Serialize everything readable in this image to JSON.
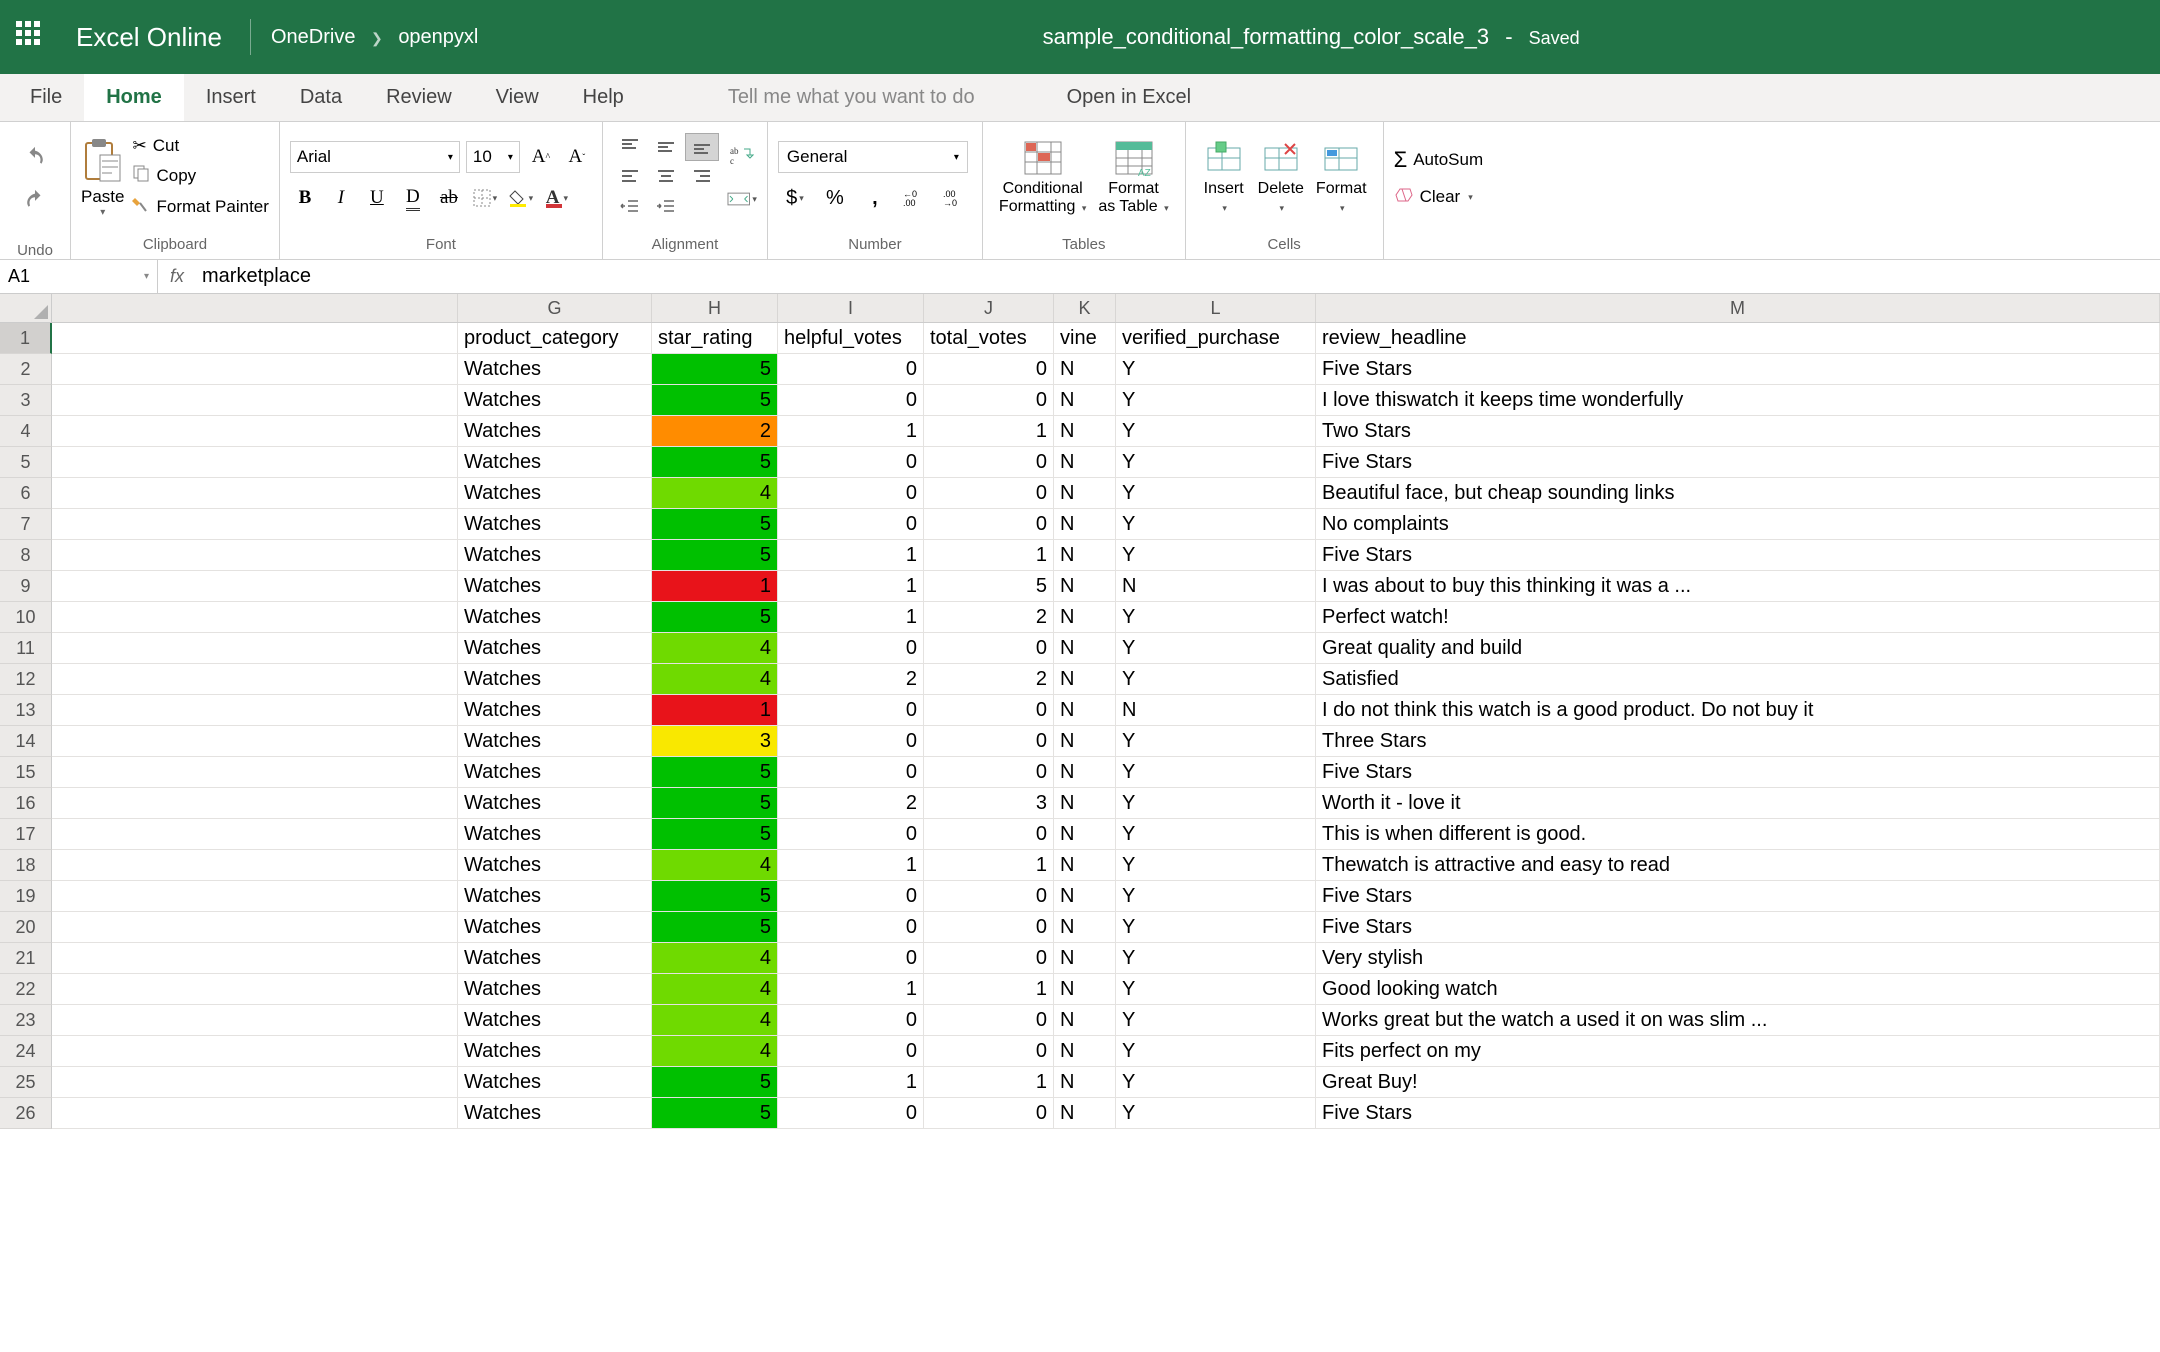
{
  "header": {
    "app_name": "Excel Online",
    "breadcrumb": [
      "OneDrive",
      "openpyxl"
    ],
    "doc_title": "sample_conditional_formatting_color_scale_3",
    "saved_status": "Saved"
  },
  "tabs": {
    "items": [
      "File",
      "Home",
      "Insert",
      "Data",
      "Review",
      "View",
      "Help"
    ],
    "active": "Home",
    "tell_me": "Tell me what you want to do",
    "open_in_excel": "Open in Excel"
  },
  "ribbon": {
    "undo_label": "Undo",
    "clipboard": {
      "paste": "Paste",
      "cut": "Cut",
      "copy": "Copy",
      "format_painter": "Format Painter",
      "label": "Clipboard"
    },
    "font": {
      "name": "Arial",
      "size": "10",
      "label": "Font"
    },
    "alignment": {
      "label": "Alignment"
    },
    "number": {
      "format": "General",
      "label": "Number"
    },
    "tables": {
      "cond_format": "Conditional\nFormatting",
      "as_table": "Format\nas Table",
      "label": "Tables"
    },
    "cells": {
      "insert": "Insert",
      "delete": "Delete",
      "format": "Format",
      "label": "Cells"
    },
    "editing": {
      "autosum": "AutoSum",
      "clear": "Clear"
    }
  },
  "formula_bar": {
    "name_box": "A1",
    "formula": "marketplace"
  },
  "grid": {
    "columns": [
      "G",
      "H",
      "I",
      "J",
      "K",
      "L",
      "M"
    ],
    "col_widths_key": [
      "cF",
      "cG",
      "cH",
      "cI",
      "cJ",
      "cK",
      "cL",
      "cM"
    ],
    "header_row": [
      "product_category",
      "star_rating",
      "helpful_votes",
      "total_votes",
      "vine",
      "verified_purchase",
      "review_headline"
    ],
    "rows": [
      {
        "g": "Watches",
        "h": 5,
        "i": 0,
        "j": 0,
        "k": "N",
        "l": "Y",
        "m": "Five Stars",
        "hc": "#00C000"
      },
      {
        "g": "Watches",
        "h": 5,
        "i": 0,
        "j": 0,
        "k": "N",
        "l": "Y",
        "m": "I love thiswatch it keeps time wonderfully",
        "hc": "#00C000"
      },
      {
        "g": "Watches",
        "h": 2,
        "i": 1,
        "j": 1,
        "k": "N",
        "l": "Y",
        "m": "Two Stars",
        "hc": "#FF8C00"
      },
      {
        "g": "Watches",
        "h": 5,
        "i": 0,
        "j": 0,
        "k": "N",
        "l": "Y",
        "m": "Five Stars",
        "hc": "#00C000"
      },
      {
        "g": "Watches",
        "h": 4,
        "i": 0,
        "j": 0,
        "k": "N",
        "l": "Y",
        "m": "Beautiful face, but cheap sounding links",
        "hc": "#6FDA00"
      },
      {
        "g": "Watches",
        "h": 5,
        "i": 0,
        "j": 0,
        "k": "N",
        "l": "Y",
        "m": "No complaints",
        "hc": "#00C000"
      },
      {
        "g": "Watches",
        "h": 5,
        "i": 1,
        "j": 1,
        "k": "N",
        "l": "Y",
        "m": "Five Stars",
        "hc": "#00C000"
      },
      {
        "g": "Watches",
        "h": 1,
        "i": 1,
        "j": 5,
        "k": "N",
        "l": "N",
        "m": "I was about to buy this thinking it was a ...",
        "hc": "#E8131A"
      },
      {
        "g": "Watches",
        "h": 5,
        "i": 1,
        "j": 2,
        "k": "N",
        "l": "Y",
        "m": "Perfect watch!",
        "hc": "#00C000"
      },
      {
        "g": "Watches",
        "h": 4,
        "i": 0,
        "j": 0,
        "k": "N",
        "l": "Y",
        "m": "Great quality and build",
        "hc": "#6FDA00"
      },
      {
        "g": "Watches",
        "h": 4,
        "i": 2,
        "j": 2,
        "k": "N",
        "l": "Y",
        "m": "Satisfied",
        "hc": "#6FDA00"
      },
      {
        "g": "Watches",
        "h": 1,
        "i": 0,
        "j": 0,
        "k": "N",
        "l": "N",
        "m": "I do not think this watch is a good product. Do not buy it",
        "hc": "#E8131A"
      },
      {
        "g": "Watches",
        "h": 3,
        "i": 0,
        "j": 0,
        "k": "N",
        "l": "Y",
        "m": "Three Stars",
        "hc": "#F9E800"
      },
      {
        "g": "Watches",
        "h": 5,
        "i": 0,
        "j": 0,
        "k": "N",
        "l": "Y",
        "m": "Five Stars",
        "hc": "#00C000"
      },
      {
        "g": "Watches",
        "h": 5,
        "i": 2,
        "j": 3,
        "k": "N",
        "l": "Y",
        "m": "Worth it - love it",
        "hc": "#00C000"
      },
      {
        "g": "Watches",
        "h": 5,
        "i": 0,
        "j": 0,
        "k": "N",
        "l": "Y",
        "m": "This is when different is good.",
        "hc": "#00C000"
      },
      {
        "g": "Watches",
        "h": 4,
        "i": 1,
        "j": 1,
        "k": "N",
        "l": "Y",
        "m": "Thewatch is attractive and easy to read",
        "hc": "#6FDA00"
      },
      {
        "g": "Watches",
        "h": 5,
        "i": 0,
        "j": 0,
        "k": "N",
        "l": "Y",
        "m": "Five Stars",
        "hc": "#00C000"
      },
      {
        "g": "Watches",
        "h": 5,
        "i": 0,
        "j": 0,
        "k": "N",
        "l": "Y",
        "m": "Five Stars",
        "hc": "#00C000"
      },
      {
        "g": "Watches",
        "h": 4,
        "i": 0,
        "j": 0,
        "k": "N",
        "l": "Y",
        "m": "Very stylish",
        "hc": "#6FDA00"
      },
      {
        "g": "Watches",
        "h": 4,
        "i": 1,
        "j": 1,
        "k": "N",
        "l": "Y",
        "m": "Good looking watch",
        "hc": "#6FDA00"
      },
      {
        "g": "Watches",
        "h": 4,
        "i": 0,
        "j": 0,
        "k": "N",
        "l": "Y",
        "m": "Works great but the watch a used it on was slim ...",
        "hc": "#6FDA00"
      },
      {
        "g": "Watches",
        "h": 4,
        "i": 0,
        "j": 0,
        "k": "N",
        "l": "Y",
        "m": "Fits perfect on my",
        "hc": "#6FDA00"
      },
      {
        "g": "Watches",
        "h": 5,
        "i": 1,
        "j": 1,
        "k": "N",
        "l": "Y",
        "m": "Great Buy!",
        "hc": "#00C000"
      },
      {
        "g": "Watches",
        "h": 5,
        "i": 0,
        "j": 0,
        "k": "N",
        "l": "Y",
        "m": "Five Stars",
        "hc": "#00C000"
      }
    ]
  }
}
